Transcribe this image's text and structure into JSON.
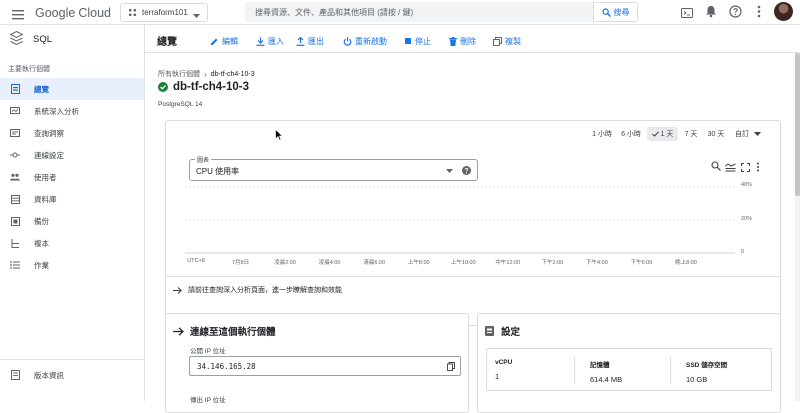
{
  "topbar": {
    "logo_google": "Google",
    "logo_cloud": "Cloud",
    "project": "terraform101",
    "search_placeholder": "搜尋資源、文件、產品和其他項目 (請按 / 鍵)",
    "search_button": "搜尋"
  },
  "sidebar": {
    "product": "SQL",
    "section_title": "主要執行個體",
    "items": [
      {
        "label": "總覽",
        "icon": "overview-icon",
        "active": true
      },
      {
        "label": "系統深入分析",
        "icon": "monitor-icon"
      },
      {
        "label": "查詢洞察",
        "icon": "query-insights-icon"
      },
      {
        "label": "連線設定",
        "icon": "connections-icon"
      },
      {
        "label": "使用者",
        "icon": "users-icon"
      },
      {
        "label": "資料庫",
        "icon": "database-icon"
      },
      {
        "label": "備份",
        "icon": "backup-icon"
      },
      {
        "label": "複本",
        "icon": "replicas-icon"
      },
      {
        "label": "作業",
        "icon": "operations-icon"
      }
    ],
    "release_notes": "版本資訊"
  },
  "toolbar": {
    "title": "總覽",
    "edit": "編輯",
    "import": "匯入",
    "export": "匯出",
    "restart": "重新啟動",
    "stop": "停止",
    "delete": "刪除",
    "clone": "複製"
  },
  "instance": {
    "breadcrumb_parent": "所有執行個體",
    "breadcrumb_current": "db-tf-ch4-10-3",
    "name": "db-tf-ch4-10-3",
    "version": "PostgreSQL 14"
  },
  "chart_panel": {
    "ranges": [
      "1 小時",
      "6 小時",
      "1 天",
      "7 天",
      "30 天",
      "自訂"
    ],
    "selected_range": "1 天",
    "selector_label": "圖表",
    "selector_value": "CPU 使用率",
    "query_insights_link": "請前往查詢深入分析頁面，進一步瞭解查詢和效能"
  },
  "chart_data": {
    "type": "line",
    "x_ticks": [
      "UTC+8",
      "7月8日",
      "凌晨2:00",
      "凌晨4:00",
      "清晨6:00",
      "上午8:00",
      "上午10:00",
      "中午12:00",
      "下午2:00",
      "下午4:00",
      "下午6:00",
      "晚上8:00"
    ],
    "y_ticks": [
      "40%",
      "20%",
      "0"
    ],
    "ylim": [
      0,
      40
    ],
    "series": [],
    "grid": true
  },
  "connect_card": {
    "title": "連線至這個執行個體",
    "public_ip_label": "公開 IP 位址",
    "public_ip": "34.146.165.28",
    "outgoing_ip_label": "傳出 IP 位址"
  },
  "config_card": {
    "title": "設定",
    "columns": [
      {
        "label": "vCPU",
        "value": "1"
      },
      {
        "label": "記憶體",
        "value": "614.4 MB"
      },
      {
        "label": "SSD 儲存空間",
        "value": "10 GB"
      }
    ]
  },
  "colors": {
    "accent": "#1a73e8",
    "active_bg": "#e8f0fe",
    "success": "#188038"
  }
}
